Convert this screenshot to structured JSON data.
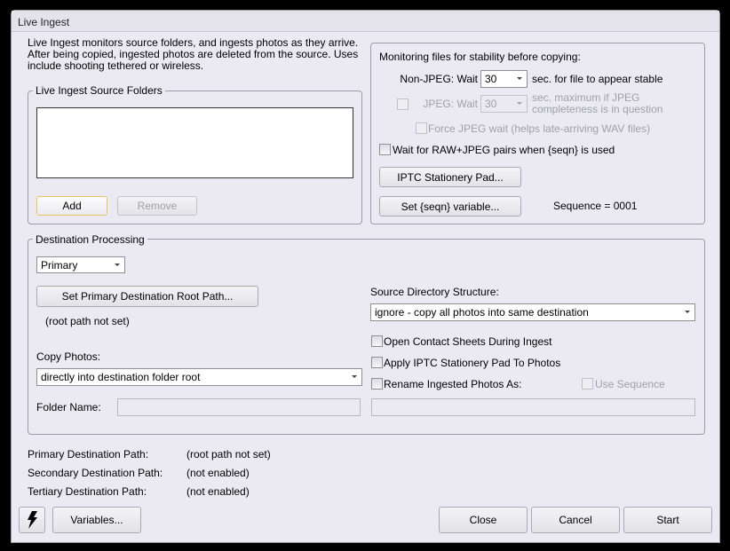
{
  "window": {
    "title": "Live Ingest"
  },
  "description": "Live Ingest monitors source folders, and ingests photos as they arrive. After being copied, ingested photos are deleted from the source. Uses include shooting tethered or wireless.",
  "source_folders": {
    "legend": "Live Ingest Source Folders",
    "items": [],
    "add_label": "Add",
    "remove_label": "Remove"
  },
  "monitoring": {
    "heading": "Monitoring files for stability before copying:",
    "nonjpeg_label": "Non-JPEG: Wait",
    "nonjpeg_value": "30",
    "nonjpeg_suffix": "sec. for file to appear stable",
    "jpeg_label": "JPEG: Wait",
    "jpeg_value": "30",
    "jpeg_suffix": "sec. maximum if JPEG completeness is in question",
    "force_jpeg_label": "Force JPEG wait (helps late-arriving WAV files)",
    "raw_jpeg_label": "Wait for RAW+JPEG pairs when {seqn} is used",
    "iptc_button": "IPTC Stationery Pad...",
    "seqn_button": "Set {seqn} variable...",
    "sequence_text": "Sequence = 0001"
  },
  "destination": {
    "legend": "Destination Processing",
    "dest_select": "Primary",
    "set_root_button": "Set Primary Destination Root Path...",
    "root_status": "(root path not set)",
    "copy_photos_label": "Copy Photos:",
    "copy_photos_value": "directly into destination folder root",
    "folder_name_label": "Folder Name:",
    "folder_name_value": "",
    "source_dir_label": "Source Directory Structure:",
    "source_dir_value": "ignore - copy all photos into same destination",
    "open_contact_label": "Open Contact Sheets During Ingest",
    "apply_iptc_label": "Apply IPTC Stationery Pad To Photos",
    "rename_label": "Rename Ingested Photos As:",
    "use_sequence_label": "Use Sequence",
    "rename_value": ""
  },
  "paths": [
    {
      "label": "Primary Destination Path:",
      "value": "(root path not set)"
    },
    {
      "label": "Secondary Destination Path:",
      "value": "(not enabled)"
    },
    {
      "label": "Tertiary Destination Path:",
      "value": "(not enabled)"
    }
  ],
  "footer": {
    "lightning_icon": "lightning-icon",
    "variables": "Variables...",
    "close": "Close",
    "cancel": "Cancel",
    "start": "Start"
  }
}
